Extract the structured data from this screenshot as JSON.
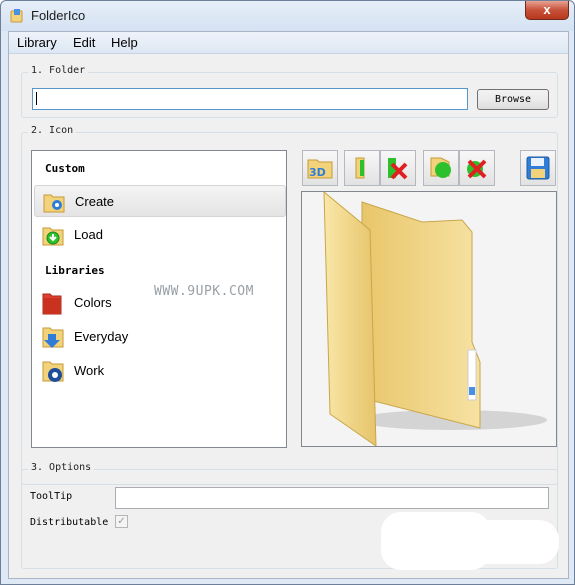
{
  "window": {
    "title": "FolderIco",
    "close_glyph": "x"
  },
  "menu": {
    "items": [
      "Library",
      "Edit",
      "Help"
    ]
  },
  "folder_group": {
    "title": "1. Folder",
    "path_value": "",
    "browse_label": "Browse"
  },
  "icon_group": {
    "title": "2. Icon",
    "custom_header": "Custom",
    "custom_items": [
      {
        "label": "Create",
        "icon": "gear-folder-icon",
        "selected": true
      },
      {
        "label": "Load",
        "icon": "download-folder-icon",
        "selected": false
      }
    ],
    "libraries_header": "Libraries",
    "library_items": [
      {
        "label": "Colors",
        "icon": "red-folder-icon"
      },
      {
        "label": "Everyday",
        "icon": "arrow-folder-icon"
      },
      {
        "label": "Work",
        "icon": "settings-folder-icon"
      }
    ],
    "toolbar": [
      {
        "name": "3d-button",
        "icon": "3d-icon",
        "text": "3D"
      },
      {
        "name": "folder-side-button",
        "icon": "folder-side-icon"
      },
      {
        "name": "remove-side-button",
        "icon": "remove-side-icon"
      },
      {
        "name": "folder-round-button",
        "icon": "folder-round-icon"
      },
      {
        "name": "remove-round-button",
        "icon": "remove-round-icon"
      },
      {
        "name": "save-button",
        "icon": "floppy-disk-icon"
      }
    ],
    "preview_icon": "large-folder-icon"
  },
  "watermark": "WWW.9UPK.COM",
  "options_group": {
    "title": "3. Options",
    "tooltip_label": "ToolTip",
    "tooltip_value": "",
    "distributable_label": "Distributable",
    "distributable_checked": true,
    "check_glyph": "✓"
  },
  "colors": {
    "folder": "#f2d27a",
    "folder_dark": "#d9b452",
    "accent_blue": "#2f7dd6",
    "accent_green": "#2cc12c",
    "accent_red": "#e02020"
  }
}
